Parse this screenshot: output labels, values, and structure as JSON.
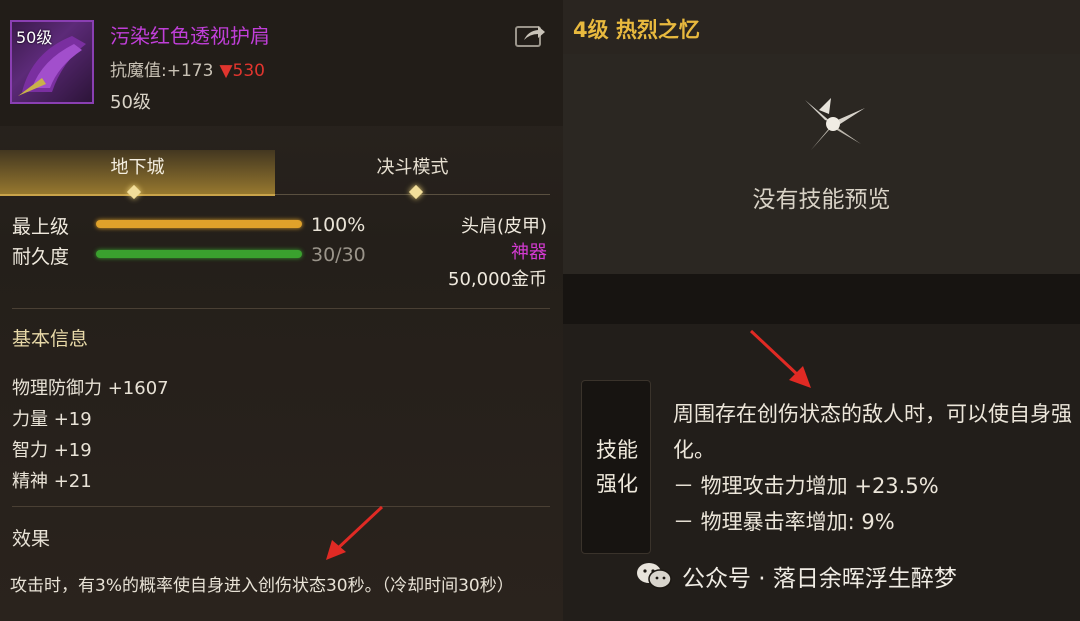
{
  "item": {
    "icon_level": "50级",
    "name": "污染红色透视护肩",
    "stat_label": "抗魔值:",
    "stat_value": "+173",
    "stat_change": "▼530",
    "level": "50级"
  },
  "tabs": [
    {
      "label": "地下城",
      "active": true
    },
    {
      "label": "决斗模式",
      "active": false
    }
  ],
  "bars": [
    {
      "label": "最上级",
      "value": "100%",
      "fraction": 1.0,
      "color": "#e0a22a"
    },
    {
      "label": "耐久度",
      "value": "30/30",
      "fraction": 1.0,
      "color": "#3aa12e"
    }
  ],
  "item_info": {
    "slot": "头肩(皮甲)",
    "rarity": "神器",
    "rarity_color": "#d23ad0",
    "price": "50,000金币"
  },
  "basic_info": {
    "title": "基本信息",
    "attributes": [
      "物理防御力 +1607",
      "力量 +19",
      "智力 +19",
      "精神 +21"
    ]
  },
  "effect": {
    "title": "效果",
    "text": "攻击时，有3%的概率使自身进入创伤状态30秒。（冷却时间30秒）"
  },
  "skill_panel": {
    "header": "4级 热烈之忆",
    "no_preview": "没有技能预览",
    "tag": "技能强化",
    "tag_line1": "技能",
    "tag_line2": "强化",
    "description": "周围存在创伤状态的敌人时，可以使自身强化。",
    "effects": [
      "－ 物理攻击力增加 +23.5%",
      "－ 物理暴击率增加: 9%"
    ]
  },
  "watermark": "公众号 · 落日余晖浮生醉梦",
  "colors": {
    "accent_gold": "#e8b93e",
    "item_name": "#c03fd8",
    "arrow_red": "#e02a24"
  }
}
